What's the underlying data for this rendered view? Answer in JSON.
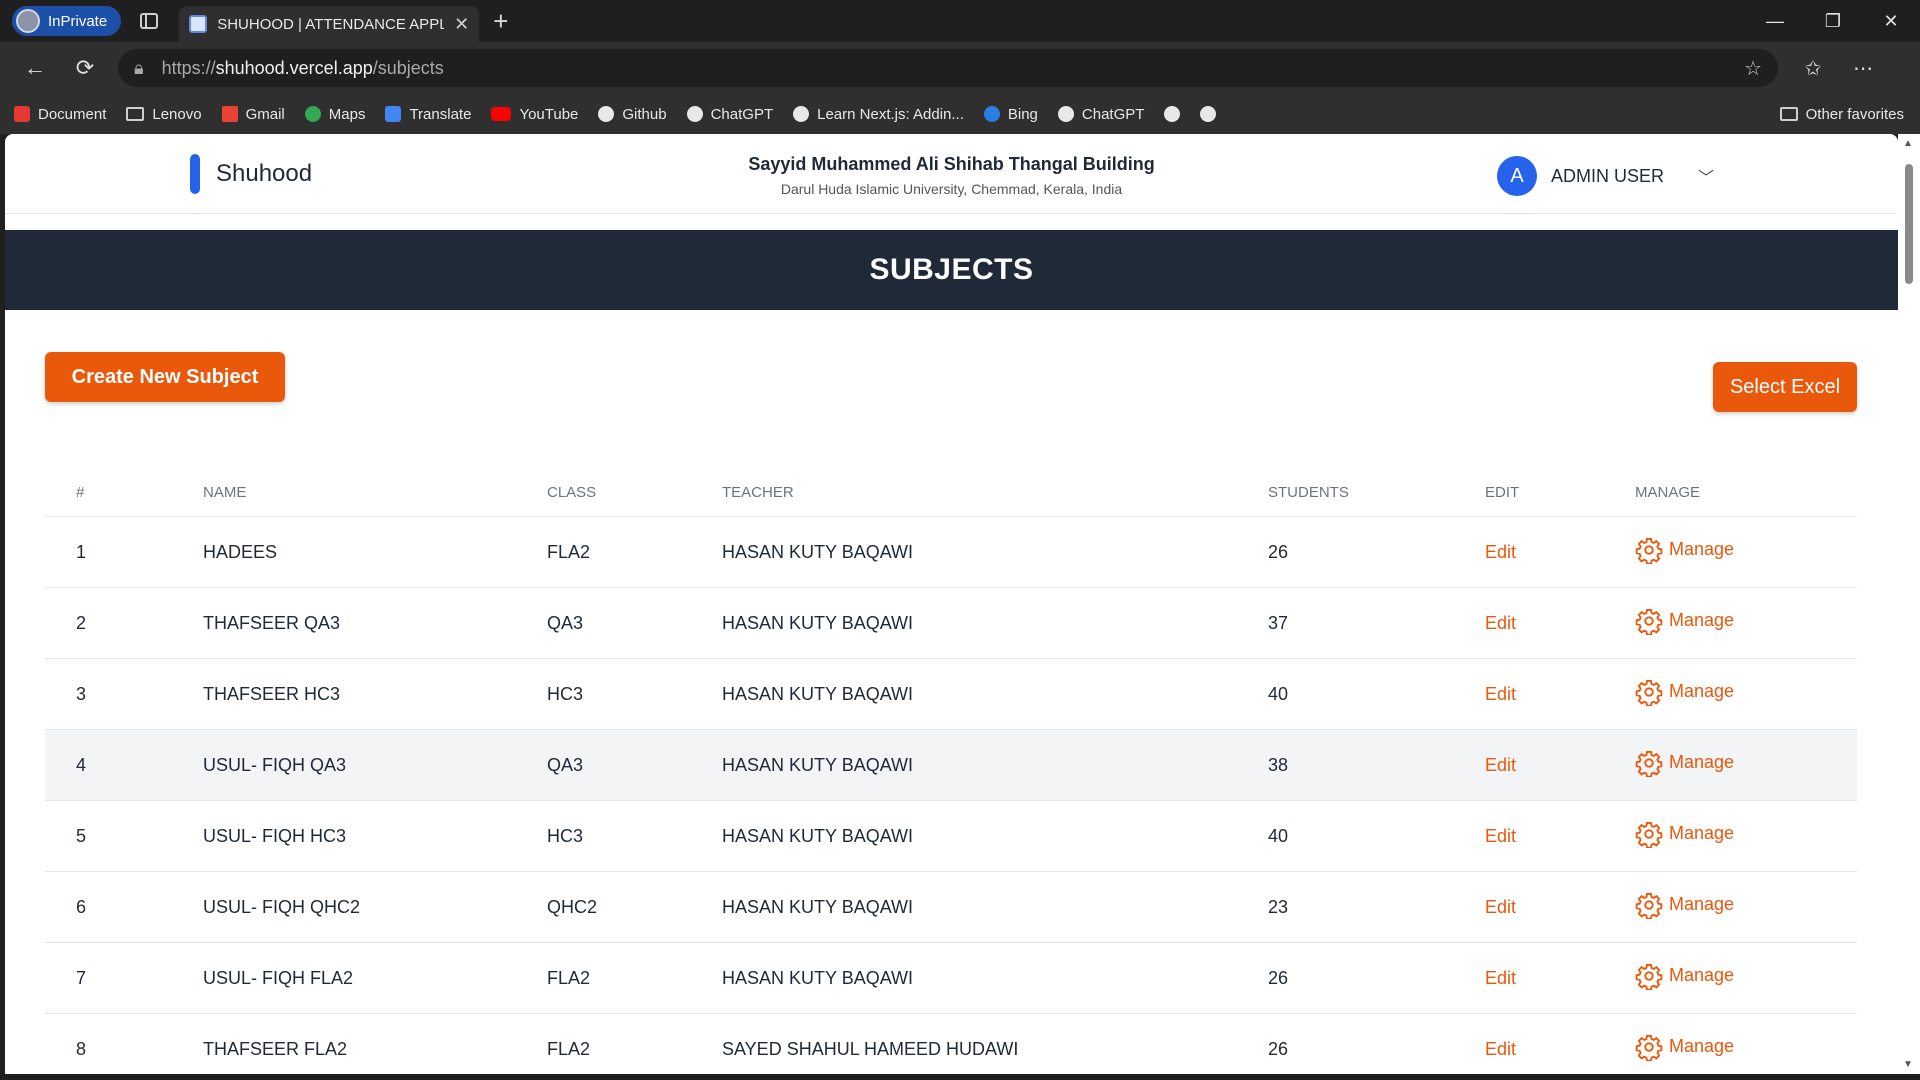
{
  "browser": {
    "inprivate_label": "InPrivate",
    "tab_title": "SHUHOOD | ATTENDANCE APPLIC",
    "url_scheme": "https://",
    "url_host": "shuhood.vercel.app",
    "url_path": "/subjects",
    "favorites": [
      {
        "label": "Document",
        "icon": "red"
      },
      {
        "label": "Lenovo",
        "icon": "folder"
      },
      {
        "label": "Gmail",
        "icon": "gmail"
      },
      {
        "label": "Maps",
        "icon": "maps"
      },
      {
        "label": "Translate",
        "icon": "translate"
      },
      {
        "label": "YouTube",
        "icon": "yt"
      },
      {
        "label": "Github",
        "icon": "white"
      },
      {
        "label": "ChatGPT",
        "icon": "white"
      },
      {
        "label": "Learn Next.js: Addin...",
        "icon": "white"
      },
      {
        "label": "Bing",
        "icon": "bing"
      },
      {
        "label": "ChatGPT",
        "icon": "white"
      },
      {
        "label": "",
        "icon": "white"
      },
      {
        "label": "",
        "icon": "white"
      }
    ],
    "other_favorites": "Other favorites"
  },
  "header": {
    "brand": "Shuhood",
    "building_name": "Sayyid Muhammed Ali Shihab Thangal Building",
    "building_address": "Darul Huda Islamic University, Chemmad, Kerala, India",
    "avatar_letter": "A",
    "user_name": "ADMIN USER"
  },
  "page": {
    "title": "SUBJECTS",
    "create_button": "Create New Subject",
    "excel_button": "Select Excel"
  },
  "table": {
    "columns": [
      "#",
      "NAME",
      "CLASS",
      "TEACHER",
      "STUDENTS",
      "EDIT",
      "MANAGE"
    ],
    "rows": [
      {
        "num": "1",
        "name": "HADEES",
        "class": "FLA2",
        "teacher": "HASAN KUTY BAQAWI",
        "students": "26",
        "edit": "Edit",
        "manage": "Manage"
      },
      {
        "num": "2",
        "name": "THAFSEER QA3",
        "class": "QA3",
        "teacher": "HASAN KUTY BAQAWI",
        "students": "37",
        "edit": "Edit",
        "manage": "Manage"
      },
      {
        "num": "3",
        "name": "THAFSEER HC3",
        "class": "HC3",
        "teacher": "HASAN KUTY BAQAWI",
        "students": "40",
        "edit": "Edit",
        "manage": "Manage"
      },
      {
        "num": "4",
        "name": "USUL- FIQH QA3",
        "class": "QA3",
        "teacher": "HASAN KUTY BAQAWI",
        "students": "38",
        "edit": "Edit",
        "manage": "Manage"
      },
      {
        "num": "5",
        "name": "USUL- FIQH HC3",
        "class": "HC3",
        "teacher": "HASAN KUTY BAQAWI",
        "students": "40",
        "edit": "Edit",
        "manage": "Manage"
      },
      {
        "num": "6",
        "name": "USUL- FIQH QHC2",
        "class": "QHC2",
        "teacher": "HASAN KUTY BAQAWI",
        "students": "23",
        "edit": "Edit",
        "manage": "Manage"
      },
      {
        "num": "7",
        "name": "USUL- FIQH FLA2",
        "class": "FLA2",
        "teacher": "HASAN KUTY BAQAWI",
        "students": "26",
        "edit": "Edit",
        "manage": "Manage"
      },
      {
        "num": "8",
        "name": "THAFSEER FLA2",
        "class": "FLA2",
        "teacher": "SAYED SHAHUL HAMEED HUDAWI",
        "students": "26",
        "edit": "Edit",
        "manage": "Manage"
      }
    ]
  },
  "colors": {
    "accent": "#ea580c",
    "banner": "#1f2937",
    "brand_bar": "#2563eb",
    "row_highlight": "#f3f4f6"
  }
}
